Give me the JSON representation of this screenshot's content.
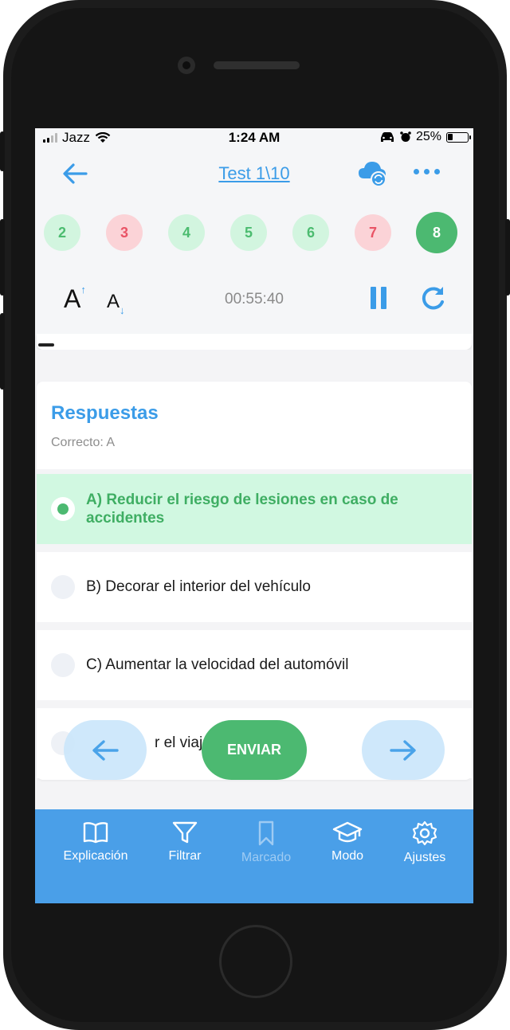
{
  "status_bar": {
    "carrier": "Jazz",
    "time": "1:24 AM",
    "battery": "25%"
  },
  "header": {
    "title": "Test 1\\10",
    "question_numbers": [
      {
        "label": "2",
        "state": "correct"
      },
      {
        "label": "3",
        "state": "incorrect"
      },
      {
        "label": "4",
        "state": "correct"
      },
      {
        "label": "5",
        "state": "correct"
      },
      {
        "label": "6",
        "state": "correct"
      },
      {
        "label": "7",
        "state": "incorrect"
      },
      {
        "label": "8",
        "state": "current"
      }
    ],
    "font_increase": "A",
    "font_decrease": "A",
    "timer": "00:55:40"
  },
  "answers": {
    "title": "Respuestas",
    "correct_label": "Correcto: A",
    "options": [
      {
        "text": "A) Reducir el riesgo de lesiones en caso de accidentes",
        "selected": true
      },
      {
        "text": "B) Decorar el interior del vehículo",
        "selected": false
      },
      {
        "text": "C) Aumentar la velocidad del automóvil",
        "selected": false
      },
      {
        "text": "r el viaje",
        "selected": false
      }
    ]
  },
  "actions": {
    "submit_label": "ENVIAR"
  },
  "bottom_nav": {
    "items": [
      {
        "label": "Explicación",
        "icon": "book-icon"
      },
      {
        "label": "Filtrar",
        "icon": "filter-icon"
      },
      {
        "label": "Marcado",
        "icon": "bookmark-icon"
      },
      {
        "label": "Modo",
        "icon": "graduation-cap-icon"
      },
      {
        "label": "Ajustes",
        "icon": "gear-icon"
      }
    ]
  },
  "colors": {
    "accent": "#3b9ce8",
    "correct": "#4cb971",
    "incorrect": "#e95466",
    "nav_bg": "#4a9fe8"
  }
}
